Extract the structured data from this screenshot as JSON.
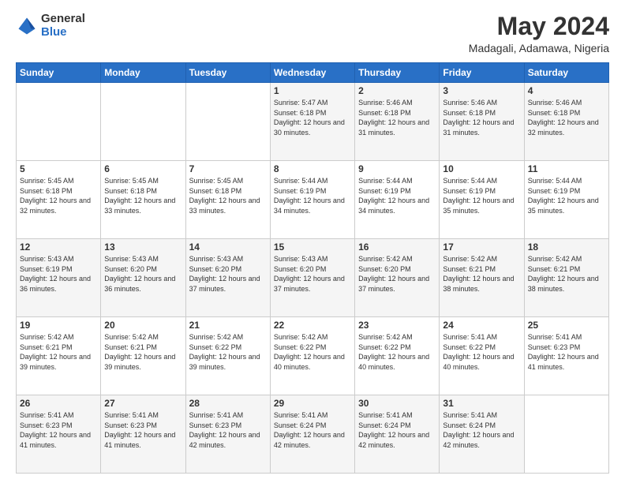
{
  "logo": {
    "general": "General",
    "blue": "Blue"
  },
  "header": {
    "month_year": "May 2024",
    "location": "Madagali, Adamawa, Nigeria"
  },
  "days_of_week": [
    "Sunday",
    "Monday",
    "Tuesday",
    "Wednesday",
    "Thursday",
    "Friday",
    "Saturday"
  ],
  "weeks": [
    [
      {
        "day": "",
        "info": ""
      },
      {
        "day": "",
        "info": ""
      },
      {
        "day": "",
        "info": ""
      },
      {
        "day": "1",
        "info": "Sunrise: 5:47 AM\nSunset: 6:18 PM\nDaylight: 12 hours and 30 minutes."
      },
      {
        "day": "2",
        "info": "Sunrise: 5:46 AM\nSunset: 6:18 PM\nDaylight: 12 hours and 31 minutes."
      },
      {
        "day": "3",
        "info": "Sunrise: 5:46 AM\nSunset: 6:18 PM\nDaylight: 12 hours and 31 minutes."
      },
      {
        "day": "4",
        "info": "Sunrise: 5:46 AM\nSunset: 6:18 PM\nDaylight: 12 hours and 32 minutes."
      }
    ],
    [
      {
        "day": "5",
        "info": "Sunrise: 5:45 AM\nSunset: 6:18 PM\nDaylight: 12 hours and 32 minutes."
      },
      {
        "day": "6",
        "info": "Sunrise: 5:45 AM\nSunset: 6:18 PM\nDaylight: 12 hours and 33 minutes."
      },
      {
        "day": "7",
        "info": "Sunrise: 5:45 AM\nSunset: 6:18 PM\nDaylight: 12 hours and 33 minutes."
      },
      {
        "day": "8",
        "info": "Sunrise: 5:44 AM\nSunset: 6:19 PM\nDaylight: 12 hours and 34 minutes."
      },
      {
        "day": "9",
        "info": "Sunrise: 5:44 AM\nSunset: 6:19 PM\nDaylight: 12 hours and 34 minutes."
      },
      {
        "day": "10",
        "info": "Sunrise: 5:44 AM\nSunset: 6:19 PM\nDaylight: 12 hours and 35 minutes."
      },
      {
        "day": "11",
        "info": "Sunrise: 5:44 AM\nSunset: 6:19 PM\nDaylight: 12 hours and 35 minutes."
      }
    ],
    [
      {
        "day": "12",
        "info": "Sunrise: 5:43 AM\nSunset: 6:19 PM\nDaylight: 12 hours and 36 minutes."
      },
      {
        "day": "13",
        "info": "Sunrise: 5:43 AM\nSunset: 6:20 PM\nDaylight: 12 hours and 36 minutes."
      },
      {
        "day": "14",
        "info": "Sunrise: 5:43 AM\nSunset: 6:20 PM\nDaylight: 12 hours and 37 minutes."
      },
      {
        "day": "15",
        "info": "Sunrise: 5:43 AM\nSunset: 6:20 PM\nDaylight: 12 hours and 37 minutes."
      },
      {
        "day": "16",
        "info": "Sunrise: 5:42 AM\nSunset: 6:20 PM\nDaylight: 12 hours and 37 minutes."
      },
      {
        "day": "17",
        "info": "Sunrise: 5:42 AM\nSunset: 6:21 PM\nDaylight: 12 hours and 38 minutes."
      },
      {
        "day": "18",
        "info": "Sunrise: 5:42 AM\nSunset: 6:21 PM\nDaylight: 12 hours and 38 minutes."
      }
    ],
    [
      {
        "day": "19",
        "info": "Sunrise: 5:42 AM\nSunset: 6:21 PM\nDaylight: 12 hours and 39 minutes."
      },
      {
        "day": "20",
        "info": "Sunrise: 5:42 AM\nSunset: 6:21 PM\nDaylight: 12 hours and 39 minutes."
      },
      {
        "day": "21",
        "info": "Sunrise: 5:42 AM\nSunset: 6:22 PM\nDaylight: 12 hours and 39 minutes."
      },
      {
        "day": "22",
        "info": "Sunrise: 5:42 AM\nSunset: 6:22 PM\nDaylight: 12 hours and 40 minutes."
      },
      {
        "day": "23",
        "info": "Sunrise: 5:42 AM\nSunset: 6:22 PM\nDaylight: 12 hours and 40 minutes."
      },
      {
        "day": "24",
        "info": "Sunrise: 5:41 AM\nSunset: 6:22 PM\nDaylight: 12 hours and 40 minutes."
      },
      {
        "day": "25",
        "info": "Sunrise: 5:41 AM\nSunset: 6:23 PM\nDaylight: 12 hours and 41 minutes."
      }
    ],
    [
      {
        "day": "26",
        "info": "Sunrise: 5:41 AM\nSunset: 6:23 PM\nDaylight: 12 hours and 41 minutes."
      },
      {
        "day": "27",
        "info": "Sunrise: 5:41 AM\nSunset: 6:23 PM\nDaylight: 12 hours and 41 minutes."
      },
      {
        "day": "28",
        "info": "Sunrise: 5:41 AM\nSunset: 6:23 PM\nDaylight: 12 hours and 42 minutes."
      },
      {
        "day": "29",
        "info": "Sunrise: 5:41 AM\nSunset: 6:24 PM\nDaylight: 12 hours and 42 minutes."
      },
      {
        "day": "30",
        "info": "Sunrise: 5:41 AM\nSunset: 6:24 PM\nDaylight: 12 hours and 42 minutes."
      },
      {
        "day": "31",
        "info": "Sunrise: 5:41 AM\nSunset: 6:24 PM\nDaylight: 12 hours and 42 minutes."
      },
      {
        "day": "",
        "info": ""
      }
    ]
  ]
}
